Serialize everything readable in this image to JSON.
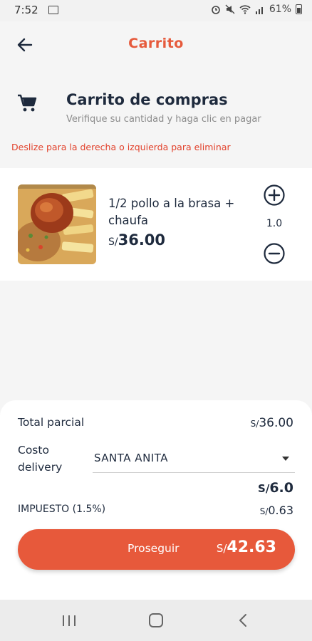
{
  "status_bar": {
    "time": "7:52",
    "battery": "61%",
    "icons": [
      "image-icon",
      "alarm-icon",
      "mute-icon",
      "wifi-icon",
      "signal-icon",
      "battery-icon"
    ]
  },
  "header": {
    "title": "Carrito",
    "back_icon": "arrow-left-icon"
  },
  "cart_section": {
    "icon": "shopping-cart-icon",
    "heading": "Carrito de compras",
    "subheading": "Verifique su cantidad y haga clic en pagar",
    "swipe_hint": "Deslize para la derecha o izquierda para eliminar"
  },
  "items": [
    {
      "name": "1/2 pollo a la brasa + chaufa",
      "currency": "S/",
      "price": "36.00",
      "quantity": "1.0"
    }
  ],
  "summary": {
    "subtotal_label": "Total parcial",
    "subtotal_currency": "S/",
    "subtotal_value": "36.00",
    "delivery_label": "Costo delivery",
    "delivery_district": "SANTA ANITA",
    "delivery_currency": "S/",
    "delivery_value": "6.0",
    "tax_label": "IMPUESTO (1.5%)",
    "tax_currency": "S/",
    "tax_value": "0.63"
  },
  "proceed": {
    "label": "Proseguir",
    "currency": "S/",
    "total": "42.63"
  },
  "colors": {
    "accent": "#e7593b",
    "title_red": "#e65a3c",
    "hint_red": "#e2402a",
    "text_dark": "#1e2a3d",
    "muted": "#8c8c8c"
  }
}
